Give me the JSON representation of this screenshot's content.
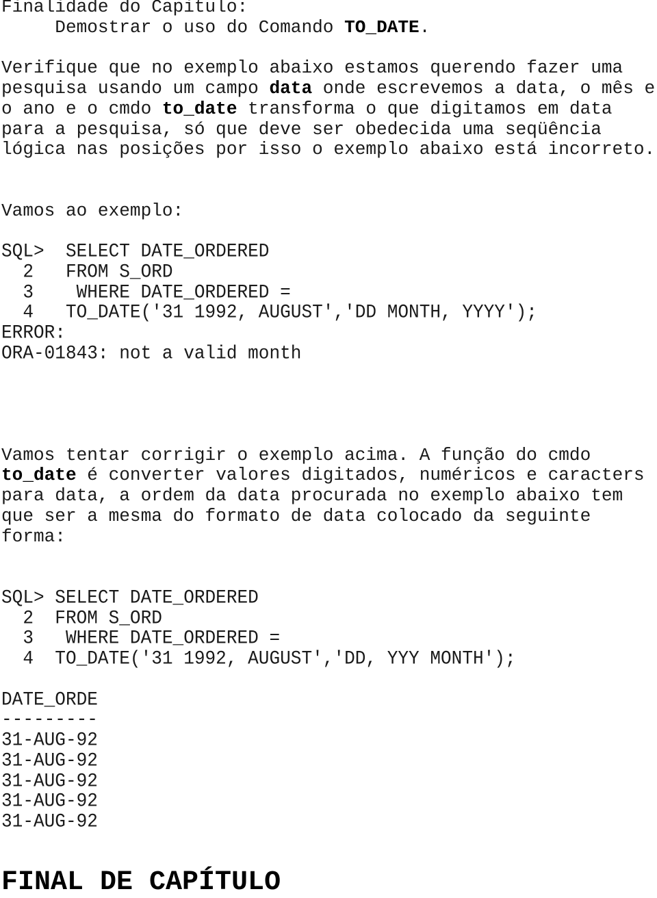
{
  "intro": {
    "heading": "Finalidade do Capitulo:",
    "purpose_prefix": "     Demostrar o uso do Comando ",
    "purpose_bold": "TO_DATE",
    "purpose_suffix": "."
  },
  "paragraph1": {
    "line1": "Verifique que no exemplo abaixo estamos querendo fazer uma",
    "line2_a": "pesquisa usando um campo ",
    "line2_bold": "data",
    "line2_b": " onde escrevemos a data, o mês e",
    "line3_a": "o ano e o cmdo ",
    "line3_bold": "to_date",
    "line3_b": " transforma o que digitamos em data",
    "line4": "para a pesquisa, só que deve ser obedecida uma seqüência",
    "line5": "lógica nas posições por isso o exemplo abaixo está incorreto."
  },
  "example1": {
    "label": "Vamos ao exemplo:",
    "sql_lines": [
      "SQL>  SELECT DATE_ORDERED",
      "  2   FROM S_ORD",
      "  3    WHERE DATE_ORDERED =",
      "  4   TO_DATE('31 1992, AUGUST','DD MONTH, YYYY');"
    ],
    "error_label": "ERROR:",
    "error_message": "ORA-01843: not a valid month"
  },
  "paragraph2": {
    "line1": "Vamos tentar corrigir o exemplo acima. A função do cmdo",
    "line2_bold": "to_date",
    "line2_b": " é converter valores digitados, numéricos e caracters",
    "line3": "para data, a ordem da data procurada no exemplo abaixo tem",
    "line4": "que ser a mesma do formato de data colocado da seguinte",
    "line5": "forma:"
  },
  "example2": {
    "sql_lines": [
      "SQL> SELECT DATE_ORDERED",
      "  2  FROM S_ORD",
      "  3   WHERE DATE_ORDERED =",
      "  4  TO_DATE('31 1992, AUGUST','DD, YYY MONTH');"
    ],
    "result_header": "DATE_ORDE",
    "result_separator": "---------",
    "result_rows": [
      "31-AUG-92",
      "31-AUG-92",
      "31-AUG-92",
      "31-AUG-92",
      "31-AUG-92"
    ]
  },
  "footer": {
    "title": "FINAL DE CAPÍTULO"
  }
}
